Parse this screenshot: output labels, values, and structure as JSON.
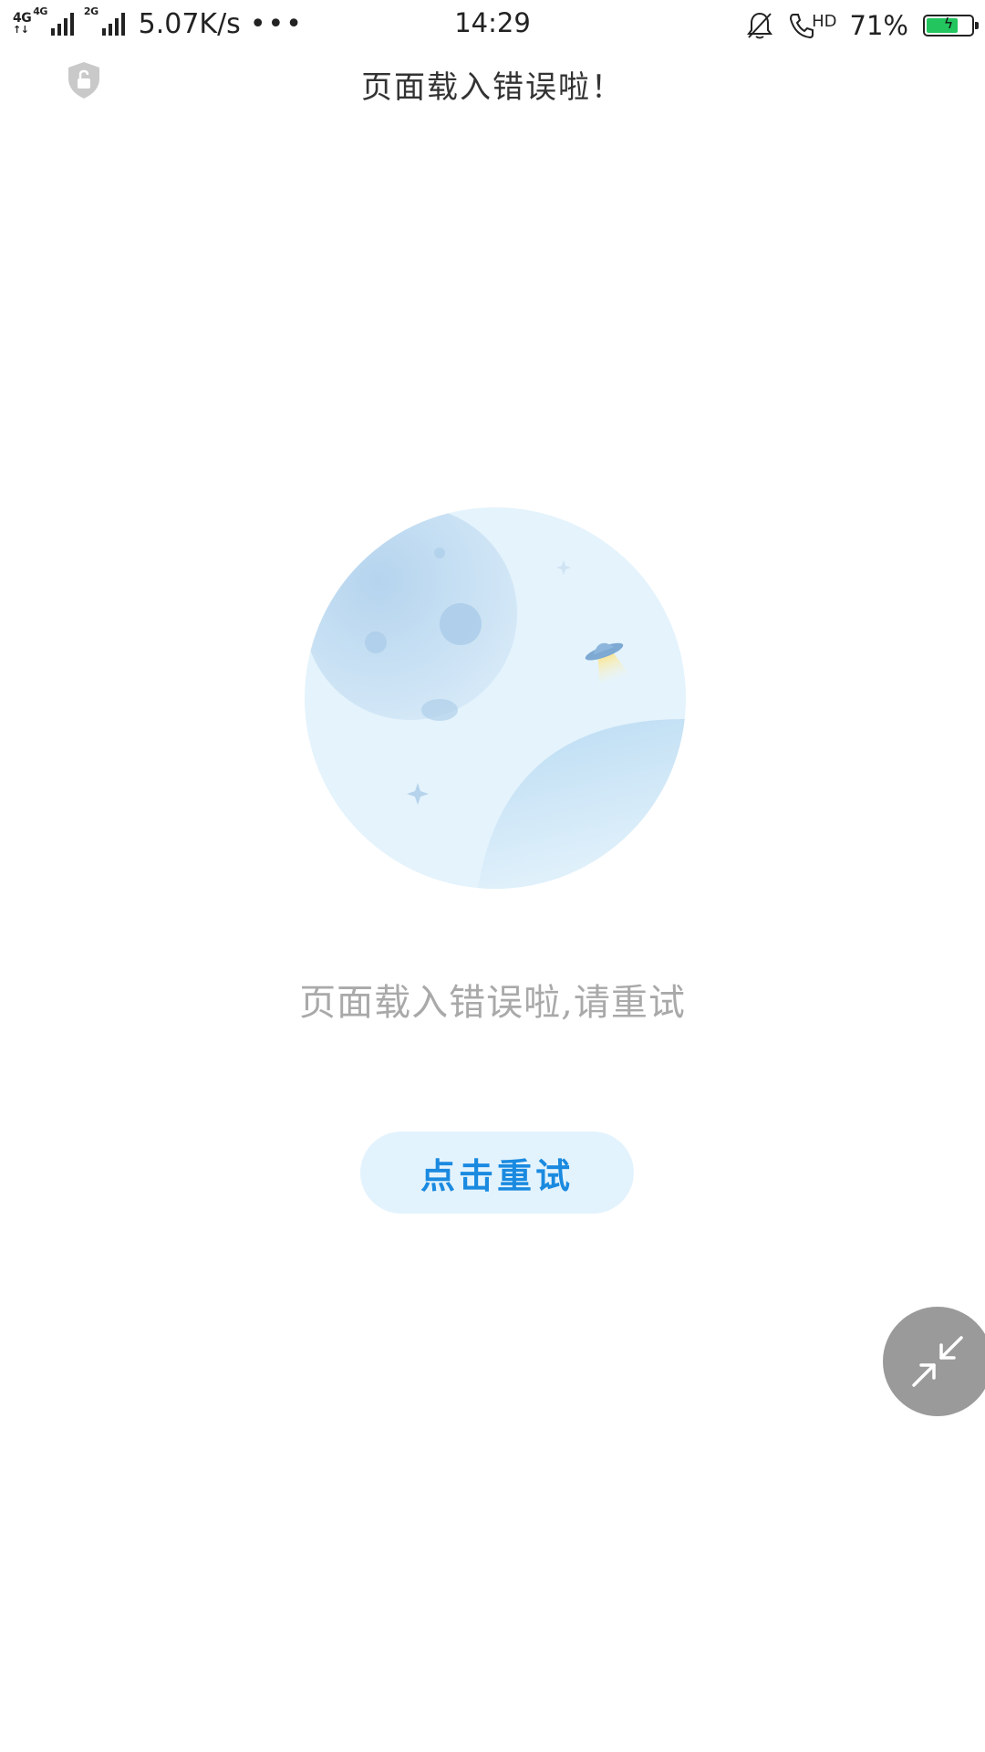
{
  "status_bar": {
    "network_1": "4G",
    "network_2": "4G",
    "network_3": "2G",
    "speed": "5.07K/s",
    "more_dots": "•••",
    "time": "14:29",
    "call_label": "HD",
    "battery_percent": "71%",
    "battery_level": 0.71,
    "battery_color": "#22c55e",
    "icons": [
      "signal-icon",
      "bell-muted-icon",
      "hd-call-icon",
      "battery-charging-icon"
    ]
  },
  "header": {
    "title": "页面载入错误啦！",
    "security_icon": "shield-lock-icon"
  },
  "main": {
    "illustration": "moon-ufo-illustration",
    "message": "页面载入错误啦,请重试",
    "retry_label": "点击重试",
    "accent_color": "#1a8ae0"
  },
  "float_button": {
    "icon": "collapse-arrows-icon",
    "color": "#9a9a9a"
  }
}
